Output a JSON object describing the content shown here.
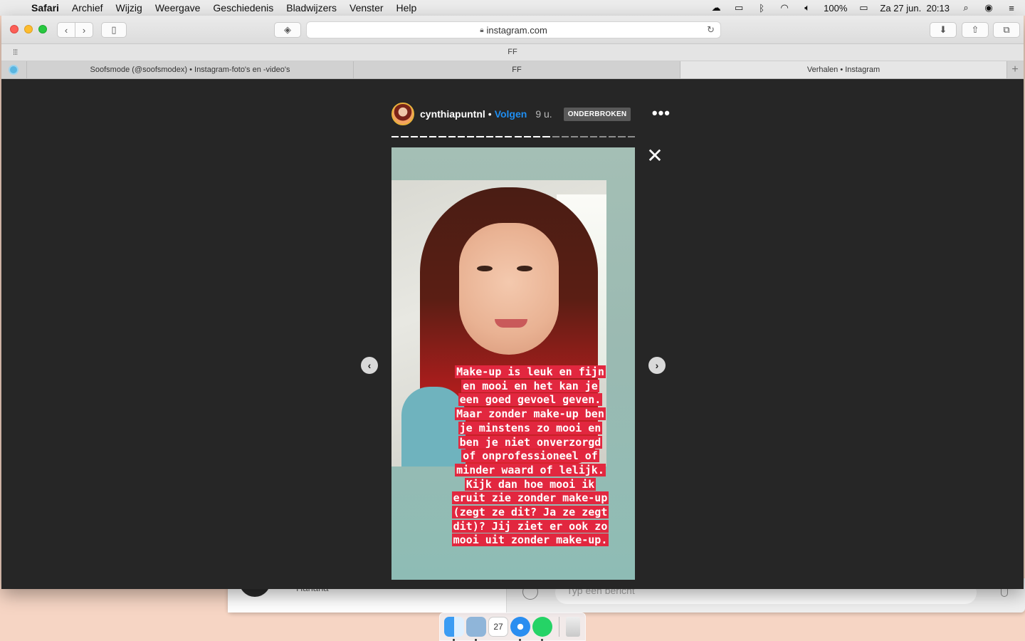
{
  "menubar": {
    "app_name": "Safari",
    "items": [
      "Archief",
      "Wijzig",
      "Weergave",
      "Geschiedenis",
      "Bladwijzers",
      "Venster",
      "Help"
    ],
    "battery": "100%",
    "datetime": "Za 27 jun.  20:13"
  },
  "browser": {
    "url": "instagram.com",
    "favorites_item": "FF",
    "tabs": [
      {
        "title": "Soofsmode (@soofsmodex) • Instagram-foto's en -video's",
        "active": false
      },
      {
        "title": "FF",
        "active": false
      },
      {
        "title": "Verhalen • Instagram",
        "active": true
      }
    ]
  },
  "story": {
    "username": "cynthiapuntnl",
    "separator": "•",
    "follow_label": "Volgen",
    "time_ago": "9 u.",
    "status_badge": "ONDERBROKEN",
    "progress": {
      "total_segments": 26,
      "completed_segments": 17,
      "seen_color": "#ffffff",
      "unseen_color": "#8e8e8e"
    },
    "text_lines": [
      "Make-up is leuk en fijn",
      "en mooi en het kan je",
      "een goed gevoel geven.",
      "Maar zonder make-up ben",
      "je minstens zo mooi en",
      "ben je niet onverzorgd",
      "of onprofessioneel of",
      "minder waard of lelijk.",
      "Kijk dan hoe mooi ik",
      "eruit zie zonder make-up",
      "(zegt ze dit? Ja ze zegt",
      "dit)? Jij ziet er ook zo",
      "mooi uit zonder make-up."
    ],
    "text_highlight_color": "#e2273f",
    "prev_icon": "chevron-left-icon",
    "next_icon": "chevron-right-icon",
    "close_icon": "close-icon"
  },
  "background_app": {
    "chat_snippet": "Hahaha",
    "compose_placeholder": "Typ een bericht"
  },
  "dock": {
    "calendar_day": "27",
    "apps": [
      "finder-icon",
      "preview-icon",
      "calendar-icon",
      "safari-icon",
      "whatsapp-icon",
      "trash-icon"
    ]
  }
}
